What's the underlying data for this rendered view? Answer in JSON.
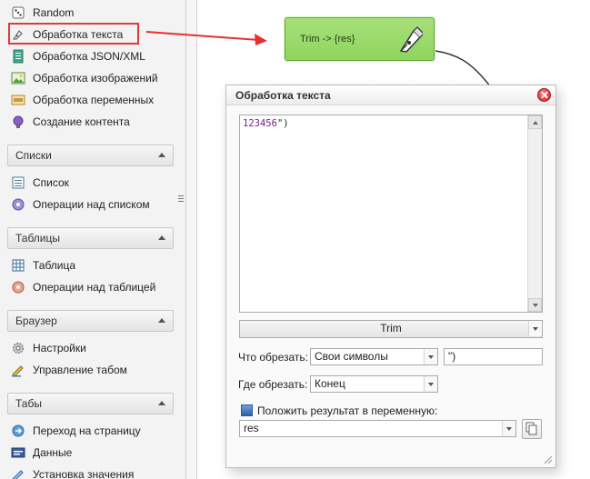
{
  "left_panel": {
    "top_items": [
      {
        "label": "Random",
        "icon": "dice-icon"
      },
      {
        "label": "Обработка текста",
        "icon": "pen-nib-icon"
      },
      {
        "label": "Обработка JSON/XML",
        "icon": "json-file-icon"
      },
      {
        "label": "Обработка изображений",
        "icon": "image-icon"
      },
      {
        "label": "Обработка переменных",
        "icon": "variables-icon"
      },
      {
        "label": "Создание контента",
        "icon": "content-bulb-icon"
      }
    ],
    "sections": [
      {
        "title": "Списки",
        "items": [
          {
            "label": "Список",
            "icon": "list-icon"
          },
          {
            "label": "Операции над списком",
            "icon": "list-gear-icon"
          }
        ]
      },
      {
        "title": "Таблицы",
        "items": [
          {
            "label": "Таблица",
            "icon": "table-icon"
          },
          {
            "label": "Операции над таблицей",
            "icon": "table-gear-icon"
          }
        ]
      },
      {
        "title": "Браузер",
        "items": [
          {
            "label": "Настройки",
            "icon": "gear-icon"
          },
          {
            "label": "Управление табом",
            "icon": "tab-pencil-icon"
          }
        ]
      },
      {
        "title": "Табы",
        "items": [
          {
            "label": "Переход на страницу",
            "icon": "navigate-icon"
          },
          {
            "label": "Данные",
            "icon": "html-icon"
          },
          {
            "label": "Установка значения",
            "icon": "set-value-icon"
          }
        ]
      }
    ]
  },
  "canvas": {
    "node_label": "Trim -> {res}",
    "node_color": "#9ad96a"
  },
  "dialog": {
    "title": "Обработка текста",
    "editor_text_colored": "123456",
    "editor_text_plain": "\")",
    "function_value": "Trim",
    "what_label": "Что обрезать:",
    "what_value": "Свои символы",
    "chars_value": "\")",
    "where_label": "Где обрезать:",
    "where_value": "Конец",
    "save_label": "Положить результат в переменную:",
    "var_value": "res"
  },
  "colors": {
    "highlight": "#e03a3a",
    "arrow": "#e53030"
  }
}
